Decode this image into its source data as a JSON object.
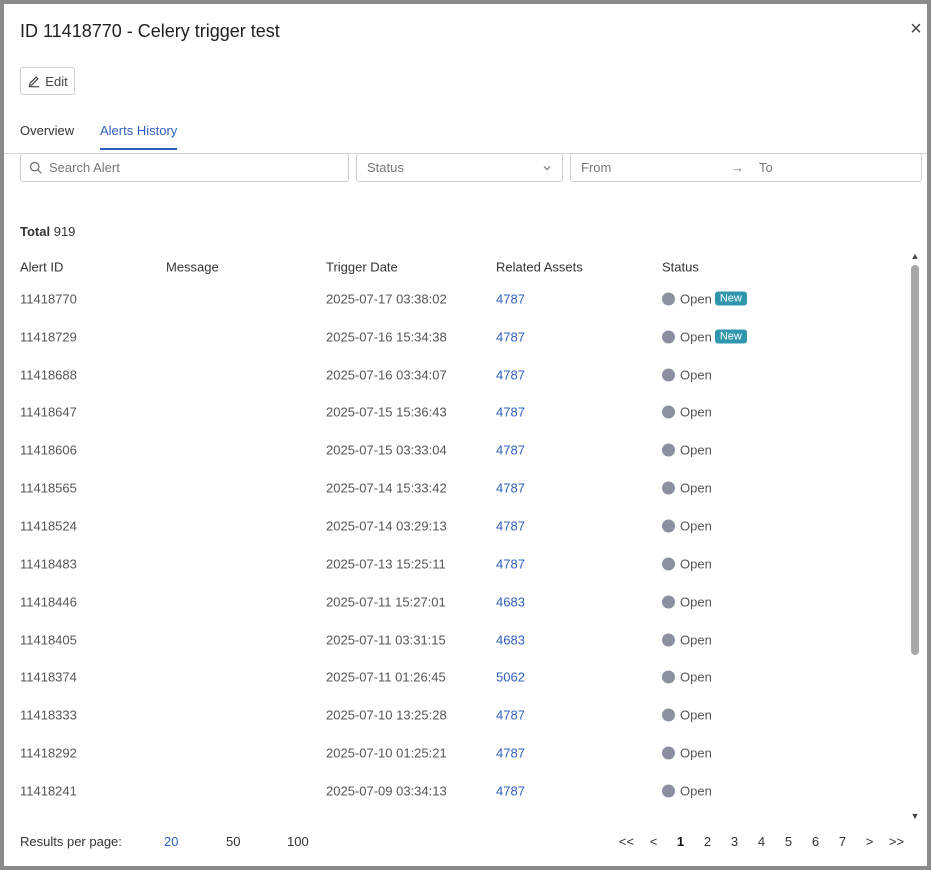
{
  "modal": {
    "title": "ID 11418770 - Celery trigger test",
    "close_label": "×",
    "edit_label": "Edit"
  },
  "tabs": [
    {
      "label": "Overview",
      "active": false
    },
    {
      "label": "Alerts History",
      "active": true
    }
  ],
  "filters": {
    "search_placeholder": "Search Alert",
    "status_placeholder": "Status",
    "from_placeholder": "From",
    "to_placeholder": "To",
    "arrow": "→"
  },
  "total": {
    "label": "Total",
    "value": "919"
  },
  "columns": [
    "Alert ID",
    "Message",
    "Trigger Date",
    "Related Assets",
    "Status"
  ],
  "rows": [
    {
      "id": "11418770",
      "message": "",
      "date": "2025-07-17 03:38:02",
      "asset": "4787",
      "status": "Open",
      "badge": "New"
    },
    {
      "id": "11418729",
      "message": "",
      "date": "2025-07-16 15:34:38",
      "asset": "4787",
      "status": "Open",
      "badge": "New"
    },
    {
      "id": "11418688",
      "message": "",
      "date": "2025-07-16 03:34:07",
      "asset": "4787",
      "status": "Open",
      "badge": ""
    },
    {
      "id": "11418647",
      "message": "",
      "date": "2025-07-15 15:36:43",
      "asset": "4787",
      "status": "Open",
      "badge": ""
    },
    {
      "id": "11418606",
      "message": "",
      "date": "2025-07-15 03:33:04",
      "asset": "4787",
      "status": "Open",
      "badge": ""
    },
    {
      "id": "11418565",
      "message": "",
      "date": "2025-07-14 15:33:42",
      "asset": "4787",
      "status": "Open",
      "badge": ""
    },
    {
      "id": "11418524",
      "message": "",
      "date": "2025-07-14 03:29:13",
      "asset": "4787",
      "status": "Open",
      "badge": ""
    },
    {
      "id": "11418483",
      "message": "",
      "date": "2025-07-13 15:25:11",
      "asset": "4787",
      "status": "Open",
      "badge": ""
    },
    {
      "id": "11418446",
      "message": "",
      "date": "2025-07-11 15:27:01",
      "asset": "4683",
      "status": "Open",
      "badge": ""
    },
    {
      "id": "11418405",
      "message": "",
      "date": "2025-07-11 03:31:15",
      "asset": "4683",
      "status": "Open",
      "badge": ""
    },
    {
      "id": "11418374",
      "message": "",
      "date": "2025-07-11 01:26:45",
      "asset": "5062",
      "status": "Open",
      "badge": ""
    },
    {
      "id": "11418333",
      "message": "",
      "date": "2025-07-10 13:25:28",
      "asset": "4787",
      "status": "Open",
      "badge": ""
    },
    {
      "id": "11418292",
      "message": "",
      "date": "2025-07-10 01:25:21",
      "asset": "4787",
      "status": "Open",
      "badge": ""
    },
    {
      "id": "11418241",
      "message": "",
      "date": "2025-07-09 03:34:13",
      "asset": "4787",
      "status": "Open",
      "badge": ""
    }
  ],
  "footer": {
    "results_per_page_label": "Results per page:",
    "page_sizes": [
      {
        "label": "20",
        "active": true
      },
      {
        "label": "50",
        "active": false
      },
      {
        "label": "100",
        "active": false
      }
    ],
    "pager": [
      {
        "label": "<<",
        "active": false
      },
      {
        "label": "<",
        "active": false
      },
      {
        "label": "1",
        "active": true
      },
      {
        "label": "2",
        "active": false
      },
      {
        "label": "3",
        "active": false
      },
      {
        "label": "4",
        "active": false
      },
      {
        "label": "5",
        "active": false
      },
      {
        "label": "6",
        "active": false
      },
      {
        "label": "7",
        "active": false
      },
      {
        "label": ">",
        "active": false
      },
      {
        "label": ">>",
        "active": false
      }
    ]
  },
  "colors": {
    "accent": "#2e5fbf",
    "badge": "#2f96ad",
    "status_dot": "#8a90a0"
  },
  "icons": [
    "edit-pencil-icon",
    "search-icon",
    "chevron-down-icon",
    "arrow-right-icon",
    "close-icon",
    "scroll-up-arrow-icon",
    "scroll-down-arrow-icon"
  ]
}
